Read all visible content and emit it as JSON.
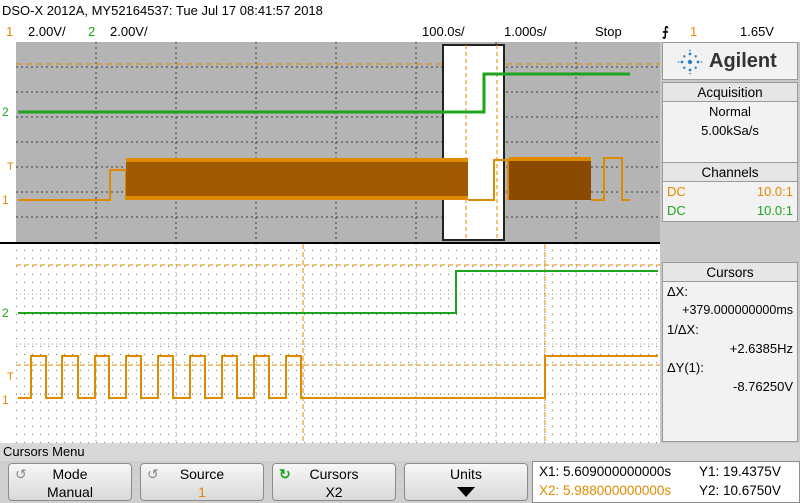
{
  "header": {
    "title": "DSO-X 2012A, MY52164537: Tue Jul 17 08:41:57 2018",
    "ch1_num": "1",
    "ch1_scale": "2.00V/",
    "ch2_num": "2",
    "ch2_scale": "2.00V/",
    "time_ref": "100.0s/",
    "timebase": "1.000s/",
    "run_state": "Stop",
    "trigger_icon": "trigger-edge-icon",
    "trigger_source": "1",
    "trigger_level": "1.65V"
  },
  "colors": {
    "ch1": "#e08a00",
    "ch2": "#1ea51e",
    "main_bg": "#b4b4b4",
    "zoom_bg": "#ffffff"
  },
  "screen": {
    "ch2_marker": "2",
    "ch1_marker": "1",
    "trigger_marker": "T"
  },
  "panel": {
    "logo": "Agilent",
    "acq_title": "Acquisition",
    "acq_mode": "Normal",
    "acq_rate": "5.00kSa/s",
    "channels_title": "Channels",
    "ch1_coupling": "DC",
    "ch1_probe": "10.0:1",
    "ch2_coupling": "DC",
    "ch2_probe": "10.0:1",
    "cursors_title": "Cursors",
    "dx_label": "ΔX:",
    "dx_value": "+379.000000000ms",
    "inv_dx_label": "1/ΔX:",
    "inv_dx_value": "+2.6385Hz",
    "dy_label": "ΔY(1):",
    "dy_value": "-8.76250V"
  },
  "menu": {
    "title": "Cursors Menu",
    "mode_label": "Mode",
    "mode_value": "Manual",
    "source_label": "Source",
    "source_value": "1",
    "cursors_label": "Cursors",
    "cursors_value": "X2",
    "units_label": "Units"
  },
  "readout": {
    "x1": "X1: 5.609000000000s",
    "x2": "X2: 5.988000000000s",
    "y1": "Y1: 19.4375V",
    "y2": "Y2: 10.6750V"
  }
}
